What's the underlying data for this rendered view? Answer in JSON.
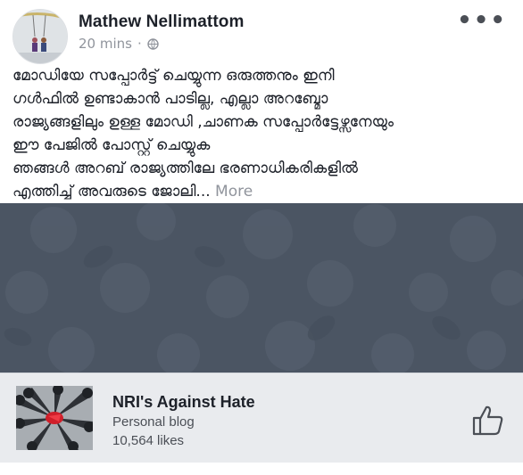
{
  "post": {
    "author": "Mathew Nellimattom",
    "timestamp": "20 mins",
    "separator": "·",
    "privacy_icon": "globe-icon",
    "options_icon": "more-options-icon",
    "text_lines": [
      "മോഡിയേ സപ്പോർട്ട് ചെയ്യുന്ന ഒരുത്തനും ഇനി",
      "ഗൾഫിൽ ഉണ്ടാകാൻ പാടില്ല, എല്ലാ അറബ്മോ",
      "രാജ്യങ്ങളിലും ഉള്ള മോഡി ,ചാണക സപ്പോർട്ടേഴ്സനേയും",
      "ഈ പേജിൽ പോസ്റ്റ് ചെയ്യുക",
      "ഞങ്ങൾ അറബ് രാജ്യത്തിലേ ഭരണാധികരികളിൽ",
      "എത്തിച്ച് അവരുടെ ജോലി..."
    ],
    "see_more": "More"
  },
  "card": {
    "title": "NRI's Against Hate",
    "subtitle": "Personal blog",
    "likes": "10,564 likes",
    "like_icon": "thumbs-up-icon"
  },
  "colors": {
    "image_bg": "#4b5563",
    "card_bg": "#e9ebee",
    "meta_text": "#90949c",
    "thumb_accent": "#d01f2a"
  }
}
